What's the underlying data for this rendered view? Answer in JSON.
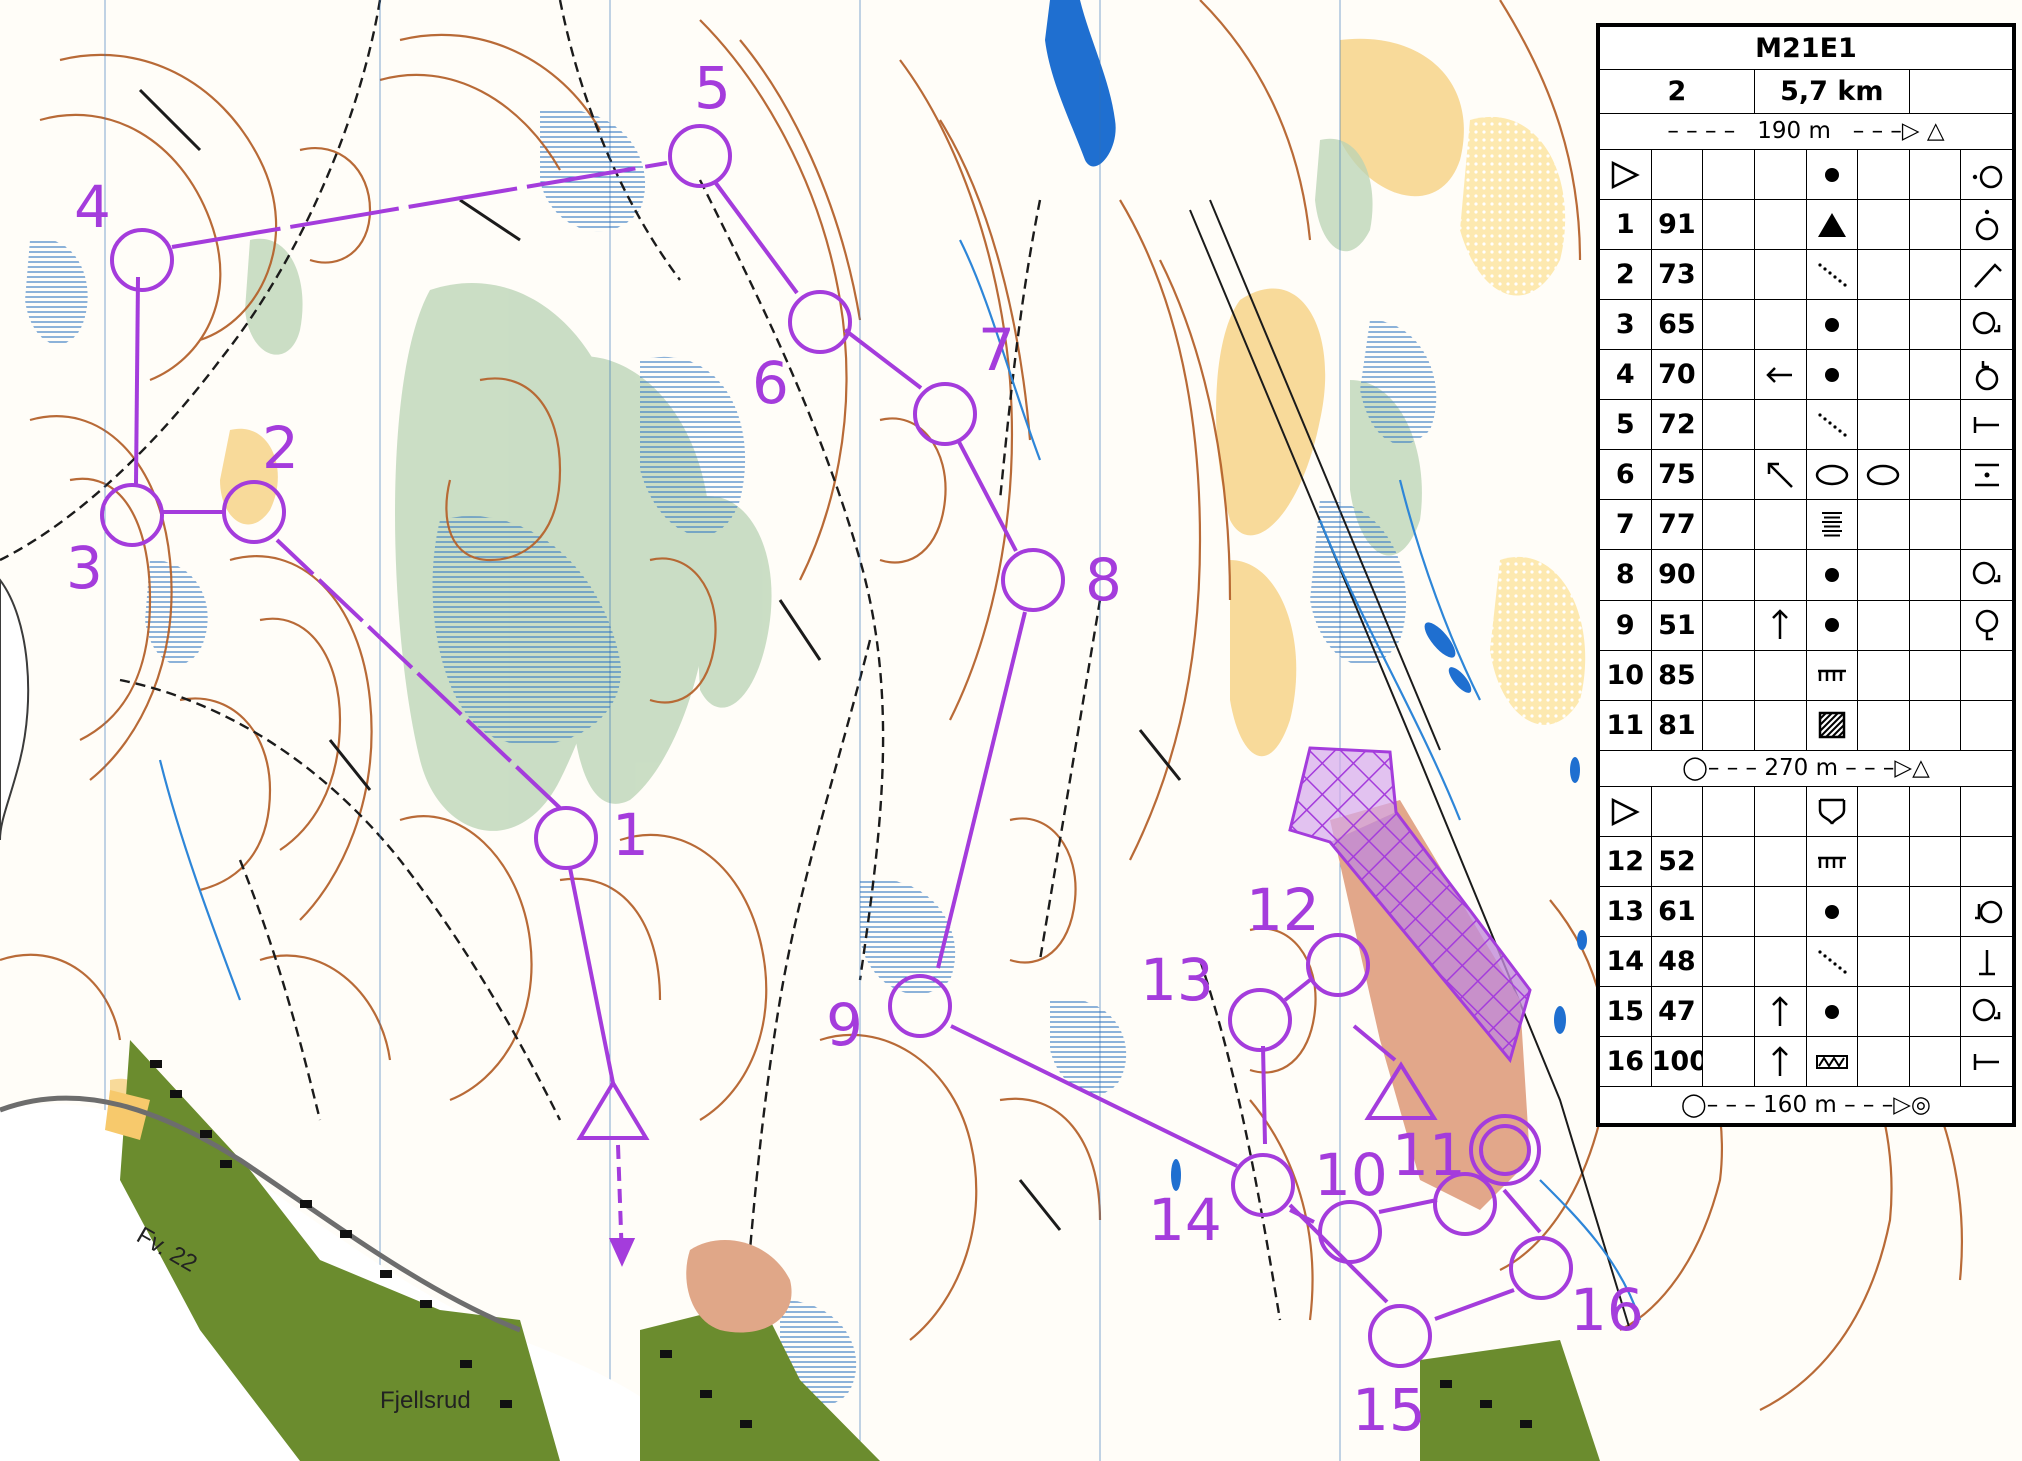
{
  "course": {
    "name": "M21E1",
    "number": "2",
    "length": "5,7 km"
  },
  "map_labels": {
    "road": "Fv. 22",
    "place": "Fjellsrud"
  },
  "colors": {
    "overprint": "#a43cdc",
    "contour": "#b5632d",
    "marsh": "#2e6fb8",
    "open_land": "#f7c96c",
    "rough_open": "#fde9b0",
    "green_veg": "#a9c9a4",
    "water": "#1f6fd0",
    "settlement": "#6b8c2e",
    "paved": "#e0b890",
    "oob": "#a43cdc"
  },
  "controls": [
    {
      "label": "1"
    },
    {
      "label": "2"
    },
    {
      "label": "3"
    },
    {
      "label": "4"
    },
    {
      "label": "5"
    },
    {
      "label": "6"
    },
    {
      "label": "7"
    },
    {
      "label": "8"
    },
    {
      "label": "9"
    },
    {
      "label": "10"
    },
    {
      "label": "11"
    },
    {
      "label": "12"
    },
    {
      "label": "13"
    },
    {
      "label": "14"
    },
    {
      "label": "15"
    },
    {
      "label": "16"
    }
  ],
  "descriptions": {
    "taped_route_1": "190 m",
    "taped_route_2": "270 m",
    "taped_route_finish": "160 m",
    "rows": [
      {
        "seq": "",
        "code": "",
        "dir": "",
        "feature": "boulder-dot",
        "feature2": "",
        "position": "top-side-icon",
        "kind": "start"
      },
      {
        "seq": "1",
        "code": "91",
        "dir": "",
        "feature": "knoll-triangle",
        "feature2": "",
        "position": "top-icon"
      },
      {
        "seq": "2",
        "code": "73",
        "dir": "",
        "feature": "ditch-dotted",
        "feature2": "",
        "position": "bend-icon"
      },
      {
        "seq": "3",
        "code": "65",
        "dir": "",
        "feature": "boulder-dot",
        "feature2": "",
        "position": "foot-side-icon"
      },
      {
        "seq": "4",
        "code": "70",
        "dir": "arrow-left-icon",
        "feature": "boulder-dot",
        "feature2": "",
        "position": "top-corner-icon"
      },
      {
        "seq": "5",
        "code": "72",
        "dir": "",
        "feature": "ditch-dotted",
        "feature2": "",
        "position": "end-icon"
      },
      {
        "seq": "6",
        "code": "75",
        "dir": "arrow-upleft-icon",
        "feature": "ellipse-open",
        "feature2": "ellipse-open",
        "position": "between-icon"
      },
      {
        "seq": "7",
        "code": "77",
        "dir": "",
        "feature": "marsh-lines",
        "feature2": "",
        "position": ""
      },
      {
        "seq": "8",
        "code": "90",
        "dir": "",
        "feature": "boulder-dot",
        "feature2": "",
        "position": "foot-side-icon"
      },
      {
        "seq": "9",
        "code": "51",
        "dir": "arrow-up-icon",
        "feature": "boulder-dot",
        "feature2": "",
        "position": "foot-bottom-icon"
      },
      {
        "seq": "10",
        "code": "85",
        "dir": "",
        "feature": "fence-comb",
        "feature2": "",
        "position": ""
      },
      {
        "seq": "11",
        "code": "81",
        "dir": "",
        "feature": "hatched-square",
        "feature2": "",
        "position": ""
      },
      {
        "seq": "",
        "code": "",
        "dir": "",
        "feature": "fork-icon",
        "feature2": "",
        "position": "",
        "kind": "start2"
      },
      {
        "seq": "12",
        "code": "52",
        "dir": "",
        "feature": "fence-comb",
        "feature2": "",
        "position": ""
      },
      {
        "seq": "13",
        "code": "61",
        "dir": "",
        "feature": "boulder-dot",
        "feature2": "",
        "position": "foot-side-left-icon"
      },
      {
        "seq": "14",
        "code": "48",
        "dir": "",
        "feature": "ditch-dotted",
        "feature2": "",
        "position": "end-bottom-icon"
      },
      {
        "seq": "15",
        "code": "47",
        "dir": "arrow-up-icon",
        "feature": "boulder-dot",
        "feature2": "",
        "position": "foot-side-icon"
      },
      {
        "seq": "16",
        "code": "100",
        "dir": "arrow-up-icon",
        "feature": "wall-zigzag",
        "feature2": "",
        "position": "end-icon"
      }
    ]
  }
}
